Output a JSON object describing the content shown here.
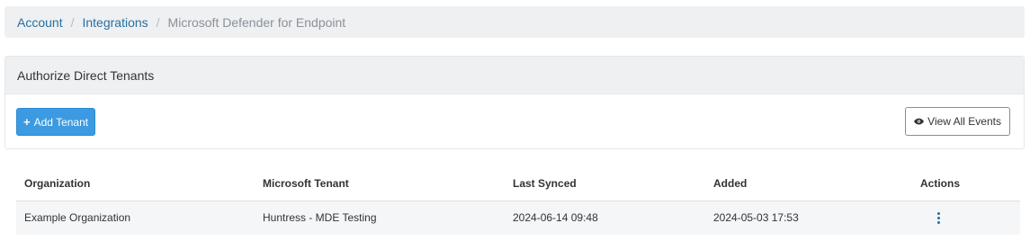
{
  "breadcrumb": {
    "items": [
      "Account",
      "Integrations"
    ],
    "separator": "/",
    "current": "Microsoft Defender for Endpoint"
  },
  "panel": {
    "title": "Authorize Direct Tenants",
    "add_button_label": "Add Tenant",
    "view_events_label": "View All Events"
  },
  "table": {
    "headers": [
      "Organization",
      "Microsoft Tenant",
      "Last Synced",
      "Added",
      "Actions"
    ],
    "rows": [
      {
        "organization": "Example Organization",
        "tenant": "Huntress - MDE Testing",
        "last_synced": "2024-06-14 09:48",
        "added": "2024-05-03 17:53"
      }
    ]
  },
  "colors": {
    "primary": "#3b9ae1",
    "link": "#2a6f9f",
    "panel_bg": "#eef0f2"
  }
}
